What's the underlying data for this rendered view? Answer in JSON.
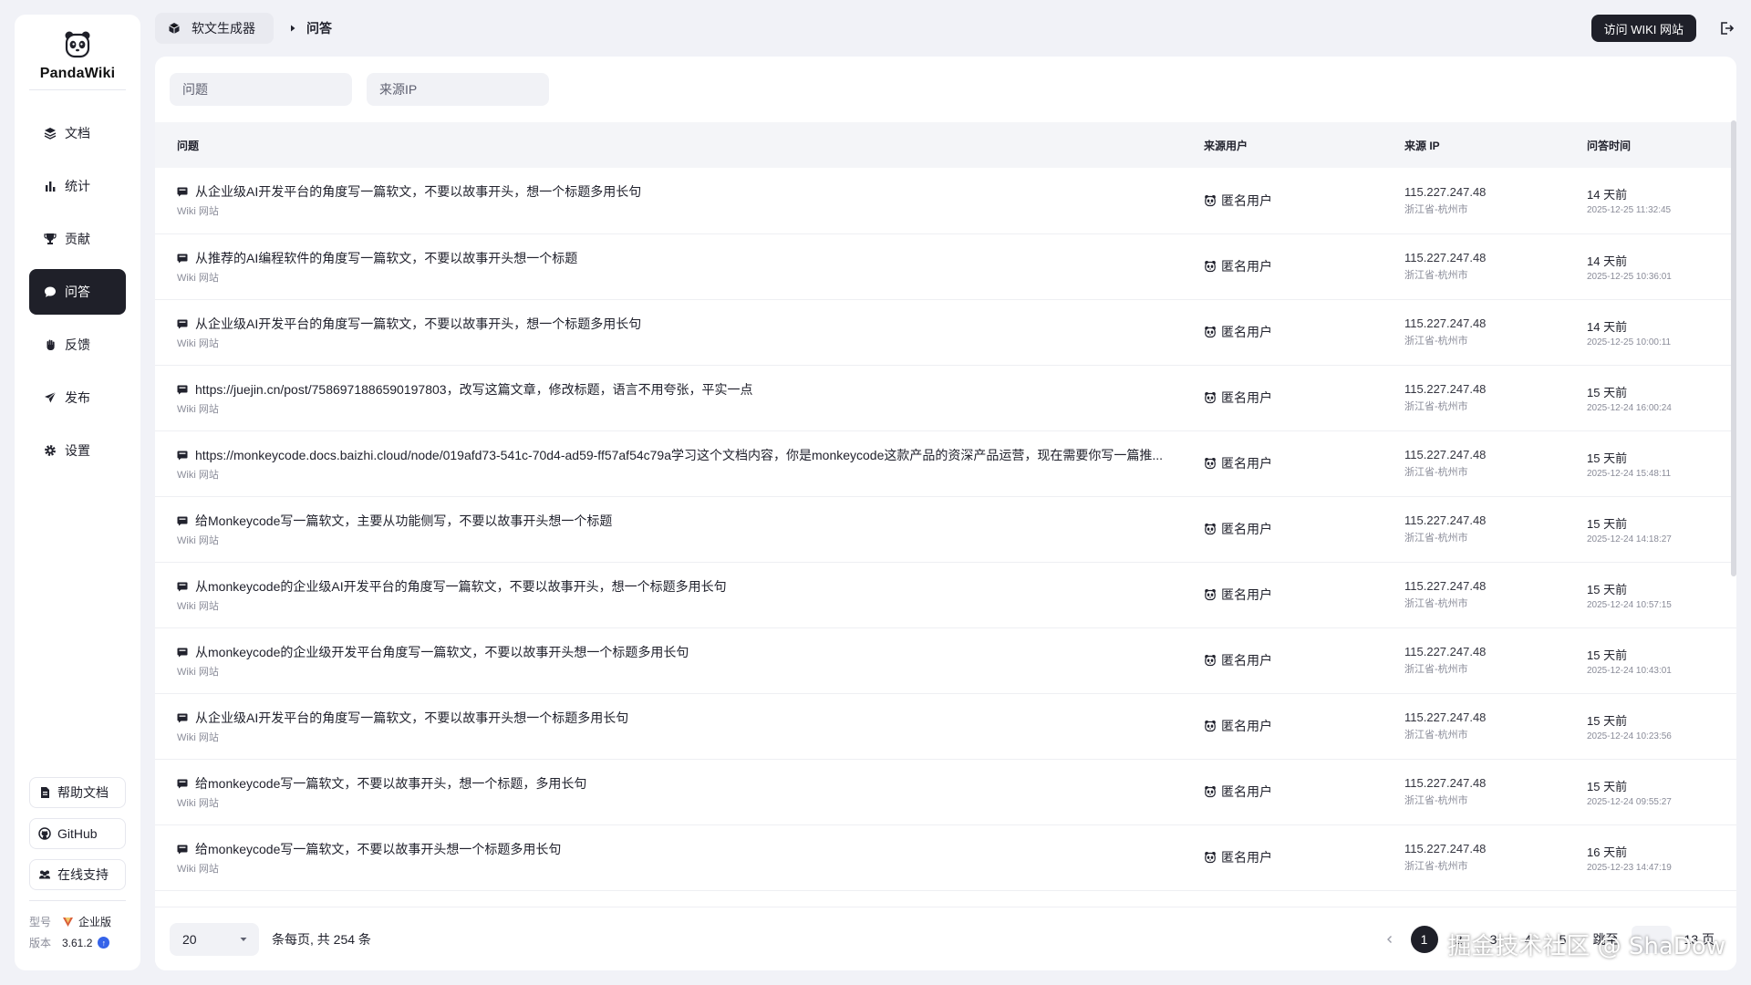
{
  "app": {
    "name": "PandaWiki"
  },
  "nav": [
    {
      "label": "文档",
      "icon": "layers-icon"
    },
    {
      "label": "统计",
      "icon": "bar-chart-icon"
    },
    {
      "label": "贡献",
      "icon": "trophy-icon"
    },
    {
      "label": "问答",
      "icon": "chat-bubble-icon",
      "active": true
    },
    {
      "label": "反馈",
      "icon": "hand-icon"
    },
    {
      "label": "发布",
      "icon": "paper-plane-icon"
    },
    {
      "label": "设置",
      "icon": "gear-icon"
    }
  ],
  "side_links": {
    "help": "帮助文档",
    "github": "GitHub",
    "support": "在线支持"
  },
  "meta": {
    "model_label": "型号",
    "model_value": "企业版",
    "version_label": "版本",
    "version_value": "3.61.2"
  },
  "breadcrumb": {
    "app": "软文生成器",
    "current": "问答"
  },
  "header": {
    "wiki_button": "访问 WIKI 网站"
  },
  "filters": {
    "question_placeholder": "问题",
    "ip_placeholder": "来源IP"
  },
  "table": {
    "columns": [
      "问题",
      "来源用户",
      "来源 IP",
      "问答时间"
    ],
    "rows": [
      {
        "question": "从企业级AI开发平台的角度写一篇软文，不要以故事开头，想一个标题多用长句",
        "source": "Wiki 网站",
        "user": "匿名用户",
        "ip": "115.227.247.48",
        "location": "浙江省-杭州市",
        "ago": "14 天前",
        "time": "2025-12-25 11:32:45"
      },
      {
        "question": "从推荐的AI编程软件的角度写一篇软文，不要以故事开头想一个标题",
        "source": "Wiki 网站",
        "user": "匿名用户",
        "ip": "115.227.247.48",
        "location": "浙江省-杭州市",
        "ago": "14 天前",
        "time": "2025-12-25 10:36:01"
      },
      {
        "question": "从企业级AI开发平台的角度写一篇软文，不要以故事开头，想一个标题多用长句",
        "source": "Wiki 网站",
        "user": "匿名用户",
        "ip": "115.227.247.48",
        "location": "浙江省-杭州市",
        "ago": "14 天前",
        "time": "2025-12-25 10:00:11"
      },
      {
        "question": "https://juejin.cn/post/7586971886590197803，改写这篇文章，修改标题，语言不用夸张，平实一点",
        "source": "Wiki 网站",
        "user": "匿名用户",
        "ip": "115.227.247.48",
        "location": "浙江省-杭州市",
        "ago": "15 天前",
        "time": "2025-12-24 16:00:24"
      },
      {
        "question": "https://monkeycode.docs.baizhi.cloud/node/019afd73-541c-70d4-ad59-ff57af54c79a学习这个文档内容，你是monkeycode这款产品的资深产品运营，现在需要你写一篇推...",
        "source": "Wiki 网站",
        "user": "匿名用户",
        "ip": "115.227.247.48",
        "location": "浙江省-杭州市",
        "ago": "15 天前",
        "time": "2025-12-24 15:48:11"
      },
      {
        "question": "给Monkeycode写一篇软文，主要从功能侧写，不要以故事开头想一个标题",
        "source": "Wiki 网站",
        "user": "匿名用户",
        "ip": "115.227.247.48",
        "location": "浙江省-杭州市",
        "ago": "15 天前",
        "time": "2025-12-24 14:18:27"
      },
      {
        "question": "从monkeycode的企业级AI开发平台的角度写一篇软文，不要以故事开头，想一个标题多用长句",
        "source": "Wiki 网站",
        "user": "匿名用户",
        "ip": "115.227.247.48",
        "location": "浙江省-杭州市",
        "ago": "15 天前",
        "time": "2025-12-24 10:57:15"
      },
      {
        "question": "从monkeycode的企业级开发平台角度写一篇软文，不要以故事开头想一个标题多用长句",
        "source": "Wiki 网站",
        "user": "匿名用户",
        "ip": "115.227.247.48",
        "location": "浙江省-杭州市",
        "ago": "15 天前",
        "time": "2025-12-24 10:43:01"
      },
      {
        "question": "从企业级AI开发平台的角度写一篇软文，不要以故事开头想一个标题多用长句",
        "source": "Wiki 网站",
        "user": "匿名用户",
        "ip": "115.227.247.48",
        "location": "浙江省-杭州市",
        "ago": "15 天前",
        "time": "2025-12-24 10:23:56"
      },
      {
        "question": "给monkeycode写一篇软文，不要以故事开头，想一个标题，多用长句",
        "source": "Wiki 网站",
        "user": "匿名用户",
        "ip": "115.227.247.48",
        "location": "浙江省-杭州市",
        "ago": "15 天前",
        "time": "2025-12-24 09:55:27"
      },
      {
        "question": "给monkeycode写一篇软文，不要以故事开头想一个标题多用长句",
        "source": "Wiki 网站",
        "user": "匿名用户",
        "ip": "115.227.247.48",
        "location": "浙江省-杭州市",
        "ago": "16 天前",
        "time": "2025-12-23 14:47:19"
      }
    ]
  },
  "pagination": {
    "page_size": "20",
    "page_info": "条每页, 共 254 条",
    "pages": [
      "1",
      "2",
      "3",
      "4",
      "5"
    ],
    "current": "1",
    "jump_label": "跳至",
    "total_pages": "13 页"
  },
  "watermark": "掘金技术社区 @ ShaDow",
  "colors": {
    "accent": "#1f2029",
    "background": "#f1f2f7",
    "version_badge": "#3563e9"
  }
}
